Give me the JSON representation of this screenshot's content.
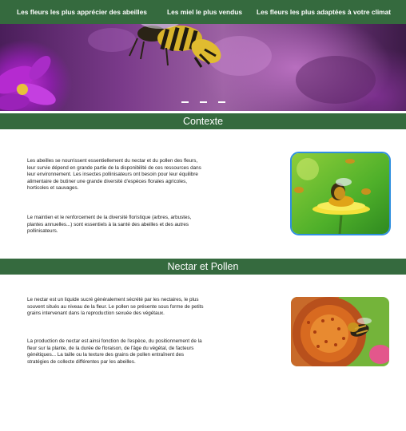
{
  "nav": {
    "items": [
      {
        "label": "Les fleurs les plus  apprécier  des abeilles"
      },
      {
        "label": "Les miel le plus vendus"
      },
      {
        "label": "Les fleurs les  plus adaptées à votre climat"
      }
    ]
  },
  "hero": {
    "slide_count": 3,
    "icon": "bee-photo"
  },
  "sections": [
    {
      "title": "Contexte",
      "paragraphs": [
        "Les abeilles se nourrissent essentiellement du nectar et du pollen des fleurs, leur survie dépend en grande partie de la disponibilité de ces ressources dans leur environnement. Les insectes pollinisateurs ont besoin pour leur équilibre alimentaire de butiner une grande diversité d'espèces florales agricoles, horticoles et sauvages.",
        "Le maintien et le renforcement de la diversité floristique (arbres, arbustes, plantes annuelles...) sont essentiels à la santé des abeilles et des autres pollinisateurs."
      ],
      "image": "bees-on-flower-photo",
      "image_border_color": "#2f8fe0"
    },
    {
      "title": "Nectar et Pollen",
      "paragraphs": [
        "Le nectar est un liquide sucré généralement sécrété par les nectaires, le plus souvent situés au niveau de la fleur. Le pollen se présente sous forme de petits grains intervenant dans la reproduction sexuée des végétaux.",
        "La production de nectar est ainsi fonction de l'espèce, du positionnement de la fleur sur la plante, de la durée de floraison, de l'âge du végétal, de facteurs génétiques... La taille ou la texture des grains de pollen entraînent des stratégies de collecte différentes par les abeilles."
      ],
      "image": "bee-on-coneflower-photo"
    }
  ],
  "colors": {
    "brand_green": "#356a3e",
    "text": "#1a1a1a"
  }
}
